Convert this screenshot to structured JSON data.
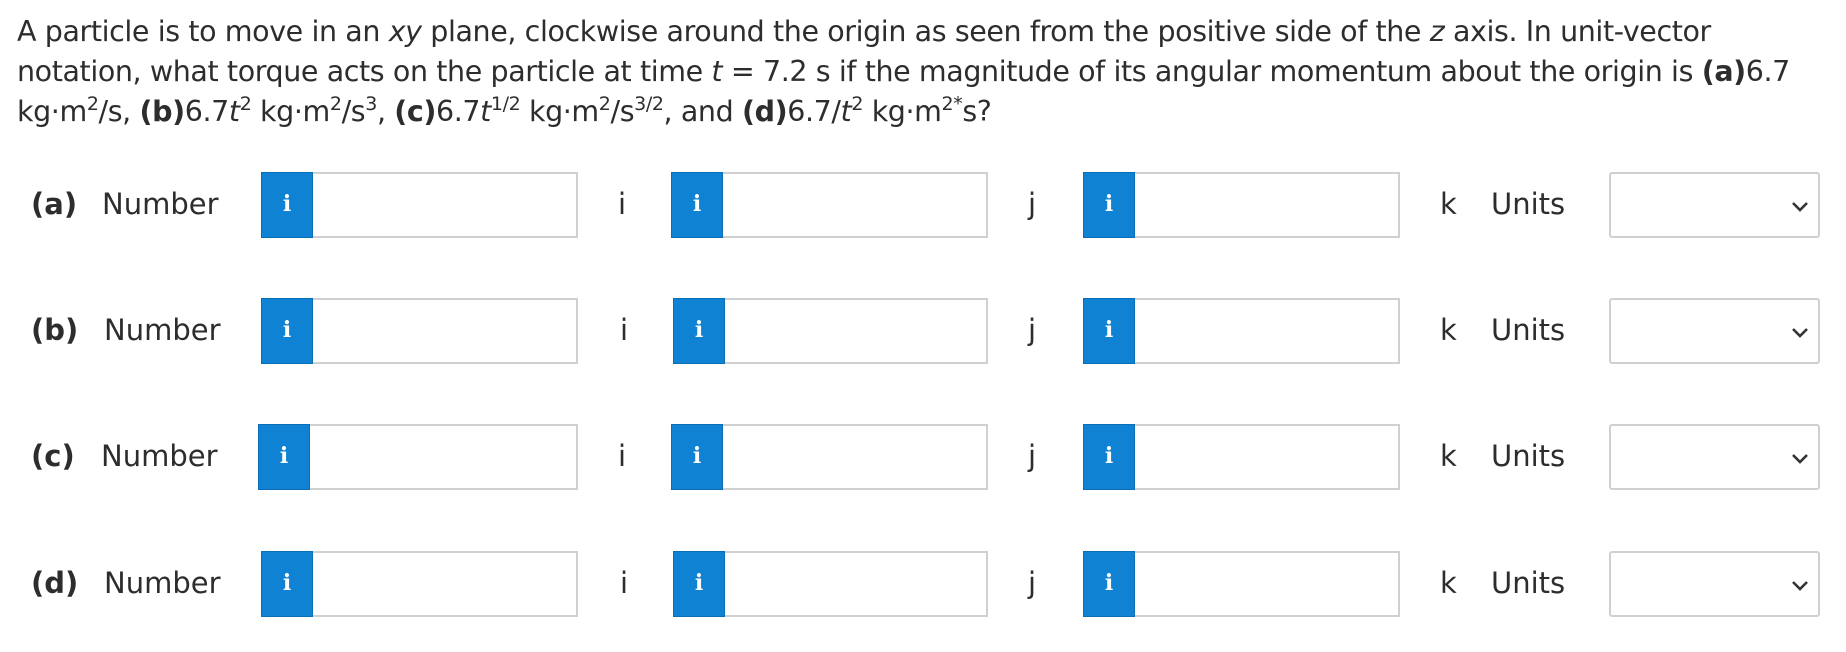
{
  "question": {
    "t1": "A particle is to move in an ",
    "t2": "xy",
    "t3": " plane, clockwise around the origin as seen from the positive side of the ",
    "t4": "z",
    "t5": " axis. In unit-vector notation, what torque acts on the particle at time ",
    "t6": "t",
    "t7": " = 7.2 s if the magnitude of its angular momentum about the origin is ",
    "a_label": "(a)",
    "a_expr": "6.7 kg·m",
    "a_exp": "2",
    "a_tail": "/s, ",
    "b_label": "(b)",
    "b_expr": "6.7",
    "b_t": "t",
    "b_exp1": "2",
    "b_mid": " kg·m",
    "b_exp2": "2",
    "b_mid2": "/s",
    "b_exp3": "3",
    "b_tail": ", ",
    "c_label": "(c)",
    "c_expr": "6.7",
    "c_t": "t",
    "c_exp1": "1/2",
    "c_mid": " kg·m",
    "c_exp2": "2",
    "c_mid2": "/s",
    "c_exp3": "3/2",
    "c_tail": ", and ",
    "d_label": "(d)",
    "d_expr": "6.7/",
    "d_t": "t",
    "d_exp1": "2",
    "d_mid": " kg·m",
    "d_exp2": "2*",
    "d_tail": "s?"
  },
  "rows": [
    {
      "part": "(a)",
      "number_label": "Number",
      "info_glyph": "i",
      "i_label": "i",
      "j_label": "j",
      "k_label": "k",
      "units_label": "Units",
      "i_value": "",
      "j_value": "",
      "k_value": "",
      "units_value": ""
    },
    {
      "part": "(b)",
      "number_label": "Number",
      "info_glyph": "i",
      "i_label": "i",
      "j_label": "j",
      "k_label": "k",
      "units_label": "Units",
      "i_value": "",
      "j_value": "",
      "k_value": "",
      "units_value": ""
    },
    {
      "part": "(c)",
      "number_label": "Number",
      "info_glyph": "i",
      "i_label": "i",
      "j_label": "j",
      "k_label": "k",
      "units_label": "Units",
      "i_value": "",
      "j_value": "",
      "k_value": "",
      "units_value": ""
    },
    {
      "part": "(d)",
      "number_label": "Number",
      "info_glyph": "i",
      "i_label": "i",
      "j_label": "j",
      "k_label": "k",
      "units_label": "Units",
      "i_value": "",
      "j_value": "",
      "k_value": "",
      "units_value": ""
    }
  ],
  "icons": {
    "info": "info-icon",
    "dropdown": "chevron-down-icon"
  },
  "colors": {
    "info_button": "#0f82d4",
    "field_border": "#d0d0d0",
    "text": "#2d2d2d"
  }
}
